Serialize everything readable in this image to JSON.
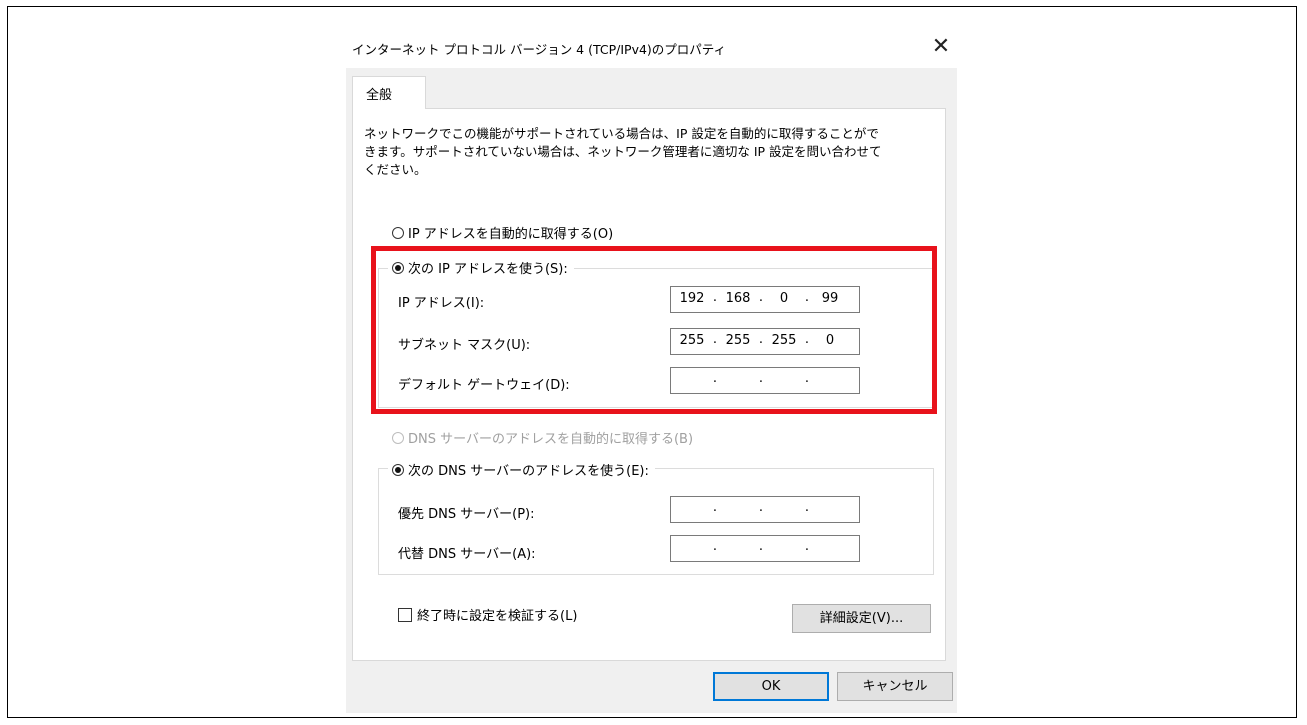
{
  "dialog": {
    "title": "インターネット プロトコル バージョン 4 (TCP/IPv4)のプロパティ",
    "close_icon": "close-icon"
  },
  "tabs": [
    {
      "label": "全般",
      "active": true
    }
  ],
  "description": "ネットワークでこの機能がサポートされている場合は、IP 設定を自動的に取得することがで\nきます。サポートされていない場合は、ネットワーク管理者に適切な IP 設定を問い合わせて\nください。",
  "ip_section": {
    "auto_radio": {
      "label": "IP アドレスを自動的に取得する(O)",
      "checked": false
    },
    "manual_radio": {
      "label": "次の IP アドレスを使う(S):",
      "checked": true
    },
    "fields": [
      {
        "label": "IP アドレス(I):",
        "octets": [
          "192",
          "168",
          "0",
          "99"
        ]
      },
      {
        "label": "サブネット マスク(U):",
        "octets": [
          "255",
          "255",
          "255",
          "0"
        ]
      },
      {
        "label": "デフォルト ゲートウェイ(D):",
        "octets": [
          "",
          "",
          "",
          ""
        ]
      }
    ]
  },
  "dns_section": {
    "auto_radio": {
      "label": "DNS サーバーのアドレスを自動的に取得する(B)",
      "checked": false,
      "disabled": true
    },
    "manual_radio": {
      "label": "次の DNS サーバーのアドレスを使う(E):",
      "checked": true
    },
    "fields": [
      {
        "label": "優先 DNS サーバー(P):",
        "octets": [
          "",
          "",
          "",
          ""
        ]
      },
      {
        "label": "代替 DNS サーバー(A):",
        "octets": [
          "",
          "",
          "",
          ""
        ]
      }
    ]
  },
  "validate_checkbox": {
    "label": "終了時に設定を検証する(L)",
    "checked": false
  },
  "buttons": {
    "advanced": "詳細設定(V)...",
    "ok": "OK",
    "cancel": "キャンセル"
  },
  "colors": {
    "highlight": "#e8121b",
    "default_button_border": "#0078d7"
  }
}
